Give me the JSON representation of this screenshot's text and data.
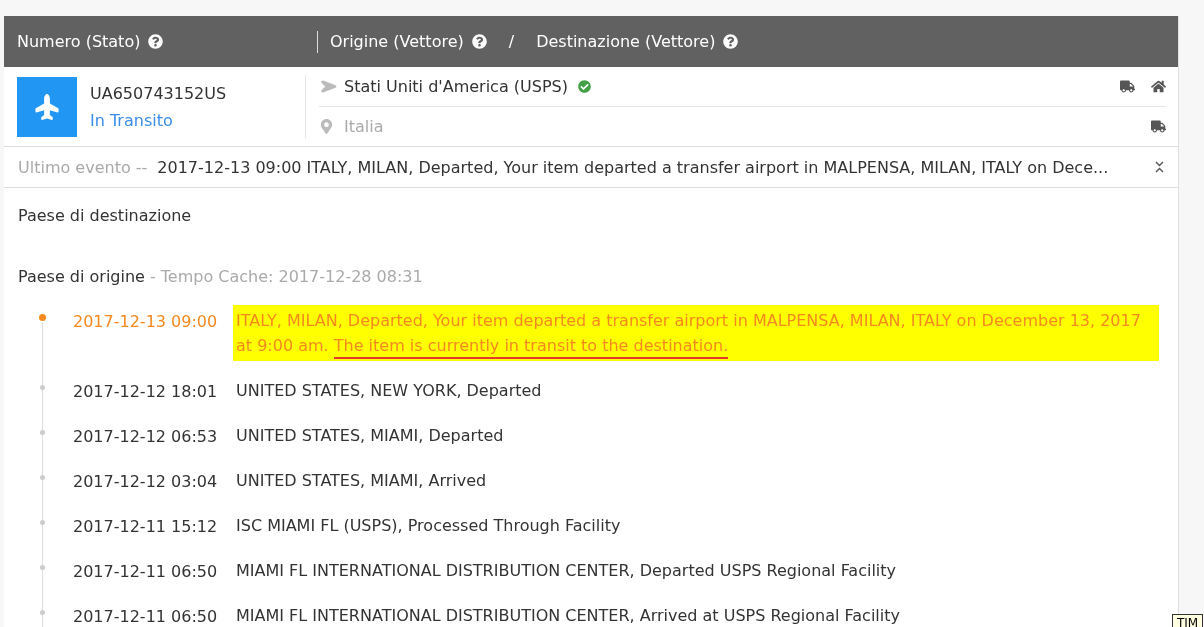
{
  "header": {
    "number_label": "Numero (Stato)",
    "origin_label": "Origine (Vettore)",
    "separator": "/",
    "destination_label": "Destinazione (Vettore)"
  },
  "shipment": {
    "number": "UA650743152US",
    "status": "In Transito",
    "origin": "Stati Uniti d'America (USPS)",
    "origin_verified": true,
    "destination": "Italia"
  },
  "last_event": {
    "label": "Ultimo evento --",
    "text": "2017-12-13 09:00 ITALY, MILAN, Departed, Your item departed a transfer airport in MALPENSA, MILAN, ITALY on Dece..."
  },
  "destination_section": {
    "title": "Paese di destinazione"
  },
  "origin_section": {
    "title": "Paese di origine",
    "cache": "- Tempo Cache: 2017-12-28 08:31"
  },
  "events": [
    {
      "time": "2017-12-13 09:00",
      "description": "ITALY, MILAN, Departed, Your item departed a transfer airport in MALPENSA, MILAN, ITALY on December 13, 2017 at 9:00 am.",
      "note": "The item is currently in transit to the destination.",
      "latest": true,
      "highlighted": true
    },
    {
      "time": "2017-12-12 18:01",
      "description": "UNITED STATES, NEW YORK, Departed",
      "latest": false,
      "highlighted": false
    },
    {
      "time": "2017-12-12 06:53",
      "description": "UNITED STATES, MIAMI, Departed",
      "latest": false,
      "highlighted": false
    },
    {
      "time": "2017-12-12 03:04",
      "description": "UNITED STATES, MIAMI, Arrived",
      "latest": false,
      "highlighted": false
    },
    {
      "time": "2017-12-11 15:12",
      "description": "ISC MIAMI FL (USPS), Processed Through Facility",
      "latest": false,
      "highlighted": false
    },
    {
      "time": "2017-12-11 06:50",
      "description": "MIAMI FL INTERNATIONAL DISTRIBUTION CENTER, Departed USPS Regional Facility",
      "latest": false,
      "highlighted": false
    },
    {
      "time": "2017-12-11 06:50",
      "description": "MIAMI FL INTERNATIONAL DISTRIBUTION CENTER, Arrived at USPS Regional Facility",
      "latest": false,
      "highlighted": false
    }
  ],
  "tooltip": {
    "text": "TIM"
  }
}
